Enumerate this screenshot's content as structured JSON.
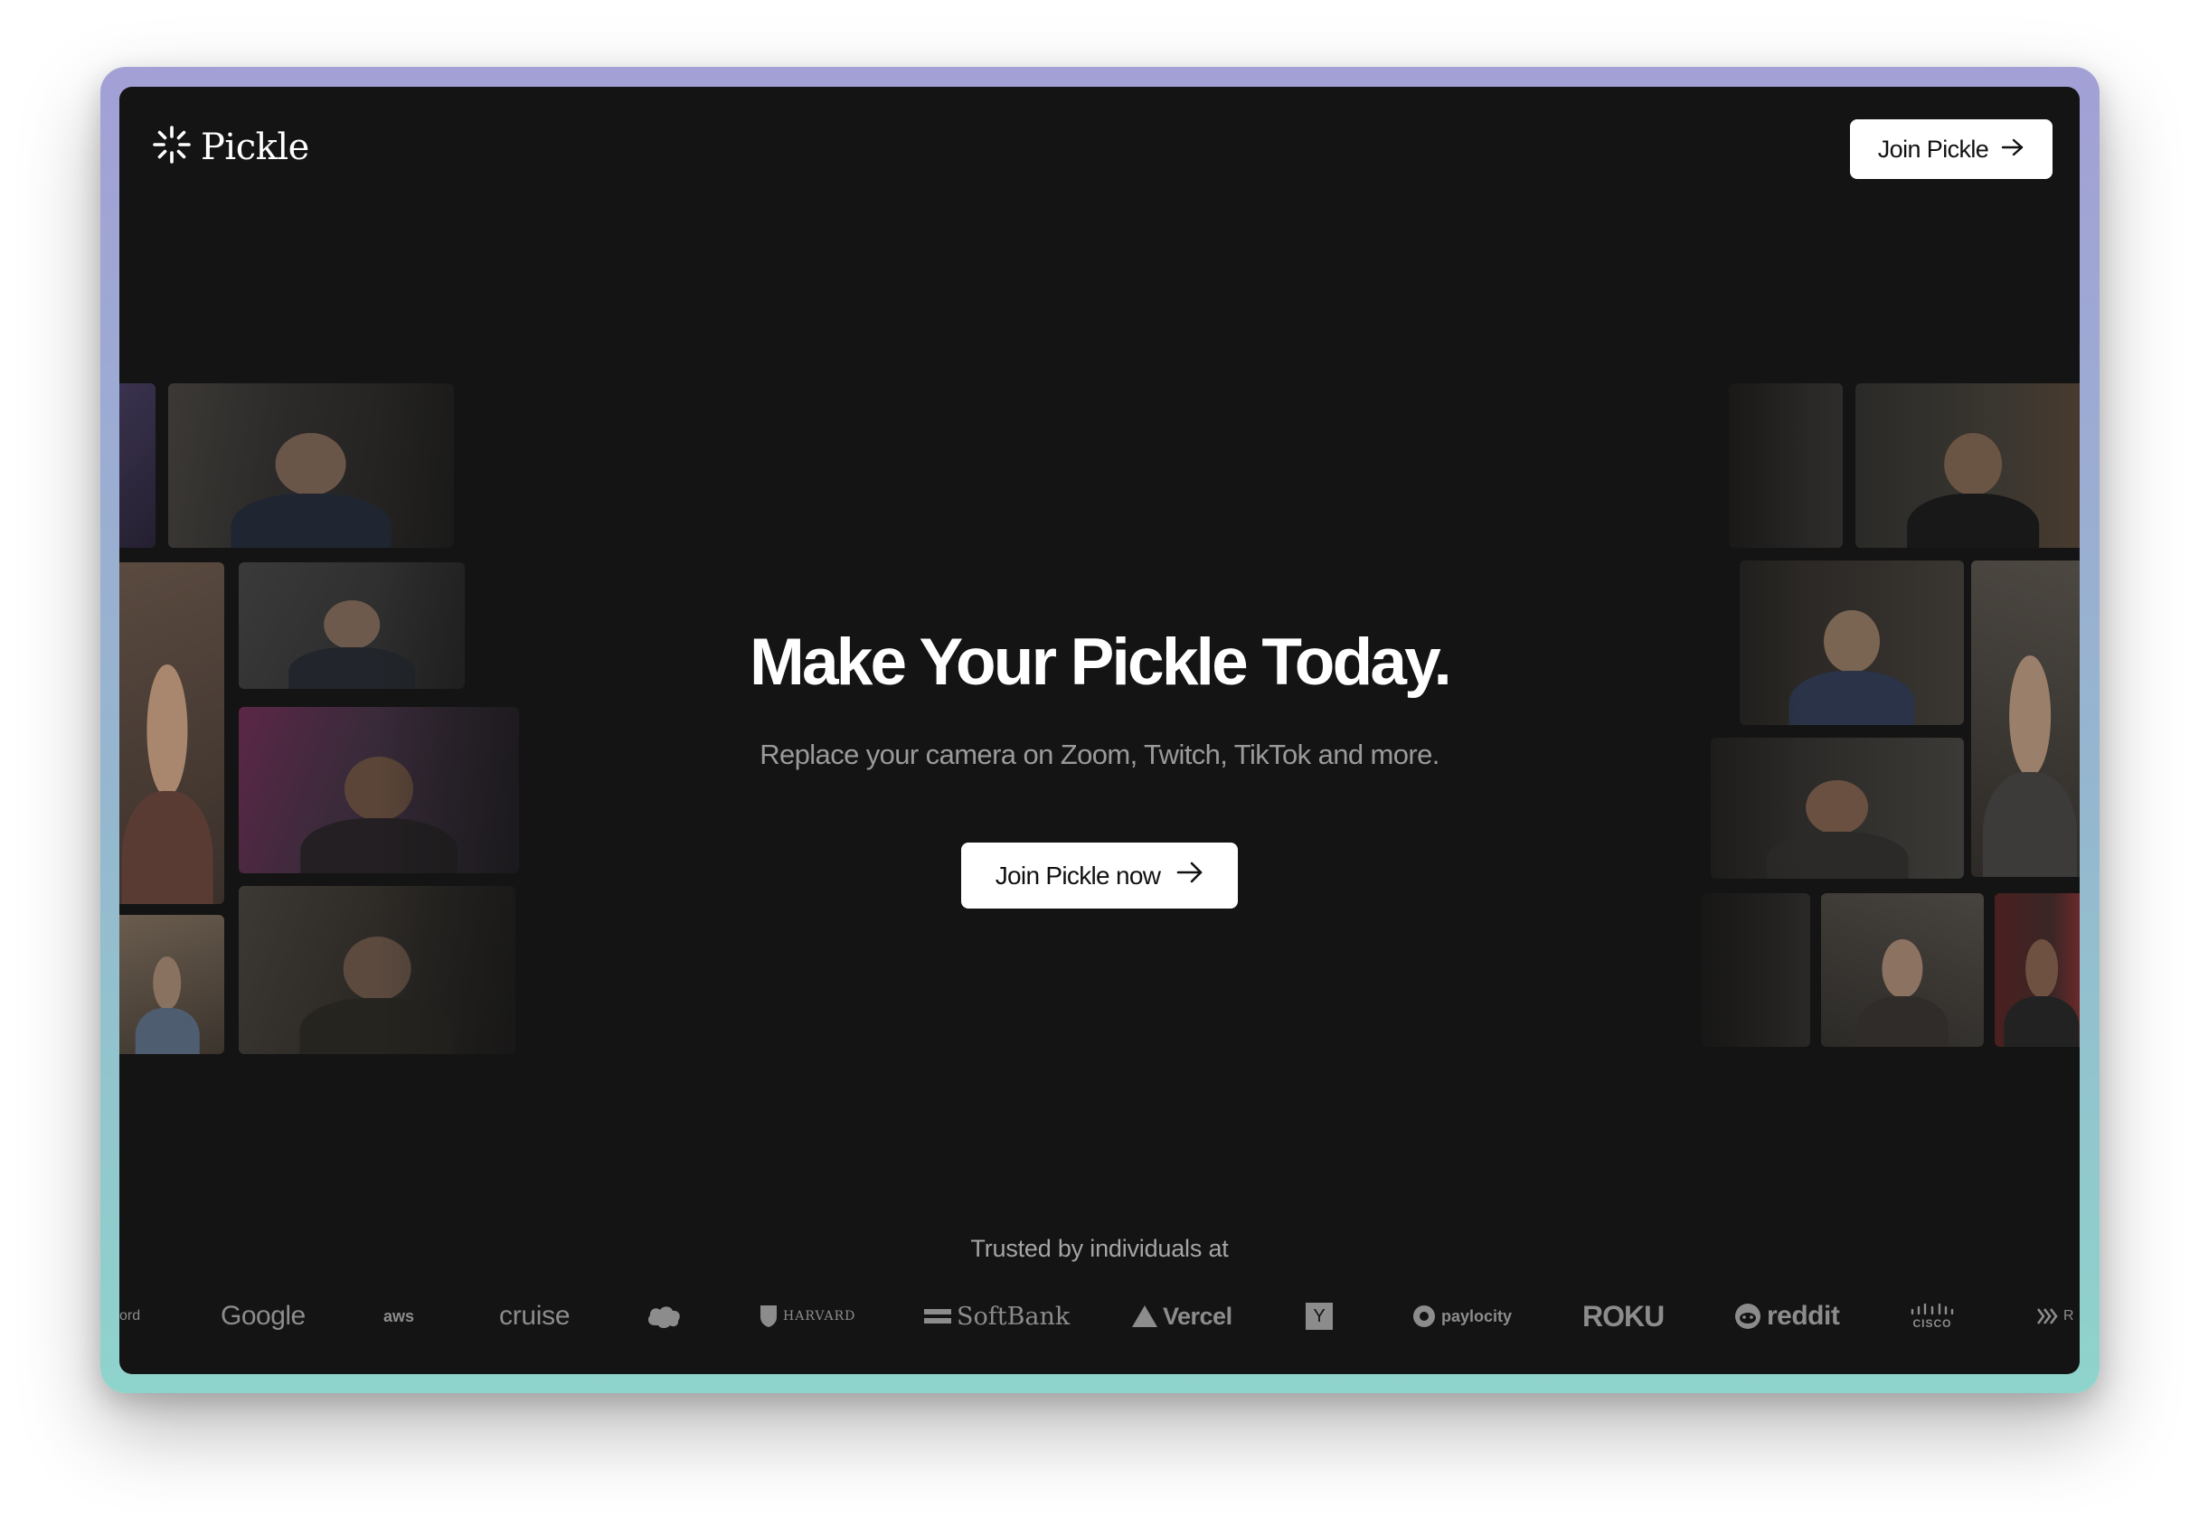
{
  "nav": {
    "brand": "Pickle",
    "join_button": "Join Pickle"
  },
  "hero": {
    "title": "Make Your Pickle Today.",
    "subtitle": "Replace your camera on Zoom, Twitch, TikTok and more.",
    "cta": "Join Pickle now"
  },
  "trusted": {
    "heading": "Trusted by individuals at",
    "logos": {
      "partial_left": "ord",
      "google": "Google",
      "aws": "aws",
      "cruise": "cruise",
      "salesforce": "salesforce",
      "harvard": "HARVARD",
      "softbank": "SoftBank",
      "vercel": "Vercel",
      "yc": "Y",
      "paylocity": "paylocity",
      "roku": "ROKU",
      "reddit": "reddit",
      "cisco": "CISCO",
      "partial_right": "R"
    }
  },
  "icons": {
    "logo": "sparkle-icon",
    "arrow": "arrow-right-icon"
  }
}
